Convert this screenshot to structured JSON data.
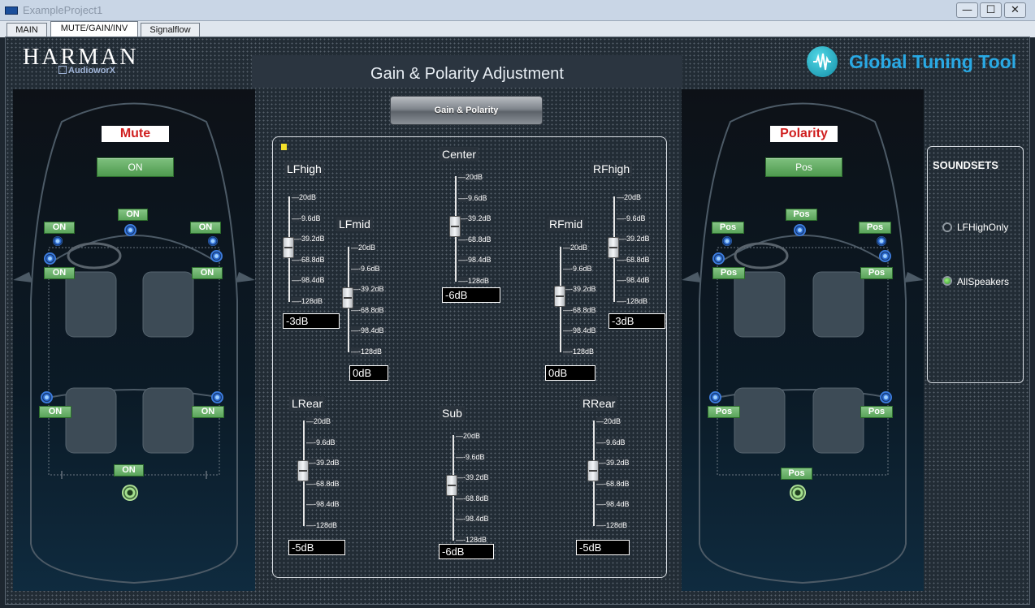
{
  "window": {
    "title": "ExampleProject1",
    "minimize": "—",
    "maximize": "☐",
    "close": "✕"
  },
  "tabs": [
    {
      "label": "MAIN"
    },
    {
      "label": "MUTE/GAIN/INV",
      "active": true
    },
    {
      "label": "Signalflow"
    }
  ],
  "branding": {
    "harman": "HARMAN",
    "audioworx": "AudioworX",
    "product": "Global Tuning Tool"
  },
  "page": {
    "title": "Gain & Polarity Adjustment",
    "mode_button": "Gain & Polarity"
  },
  "mute_panel": {
    "label": "Mute",
    "master": "ON",
    "speaker_tag": "ON"
  },
  "polarity_panel": {
    "label": "Polarity",
    "master": "Pos",
    "speaker_tag": "Pos"
  },
  "channels": [
    {
      "name": "LFhigh",
      "value": "-3dB"
    },
    {
      "name": "LFmid",
      "value": "0dB"
    },
    {
      "name": "Center",
      "value": "-6dB"
    },
    {
      "name": "RFmid",
      "value": "0dB"
    },
    {
      "name": "RFhigh",
      "value": "-3dB"
    },
    {
      "name": "LRear",
      "value": "-5dB"
    },
    {
      "name": "Sub",
      "value": "-6dB"
    },
    {
      "name": "RRear",
      "value": "-5dB"
    }
  ],
  "fader_scale": [
    "20dB",
    "-9.6dB",
    "-39.2dB",
    "-68.8dB",
    "-98.4dB",
    "-128dB"
  ],
  "soundsets": {
    "title": "SOUNDSETS",
    "options": [
      {
        "label": "LFHighOnly",
        "selected": false
      },
      {
        "label": "AllSpeakers",
        "selected": true
      }
    ]
  }
}
